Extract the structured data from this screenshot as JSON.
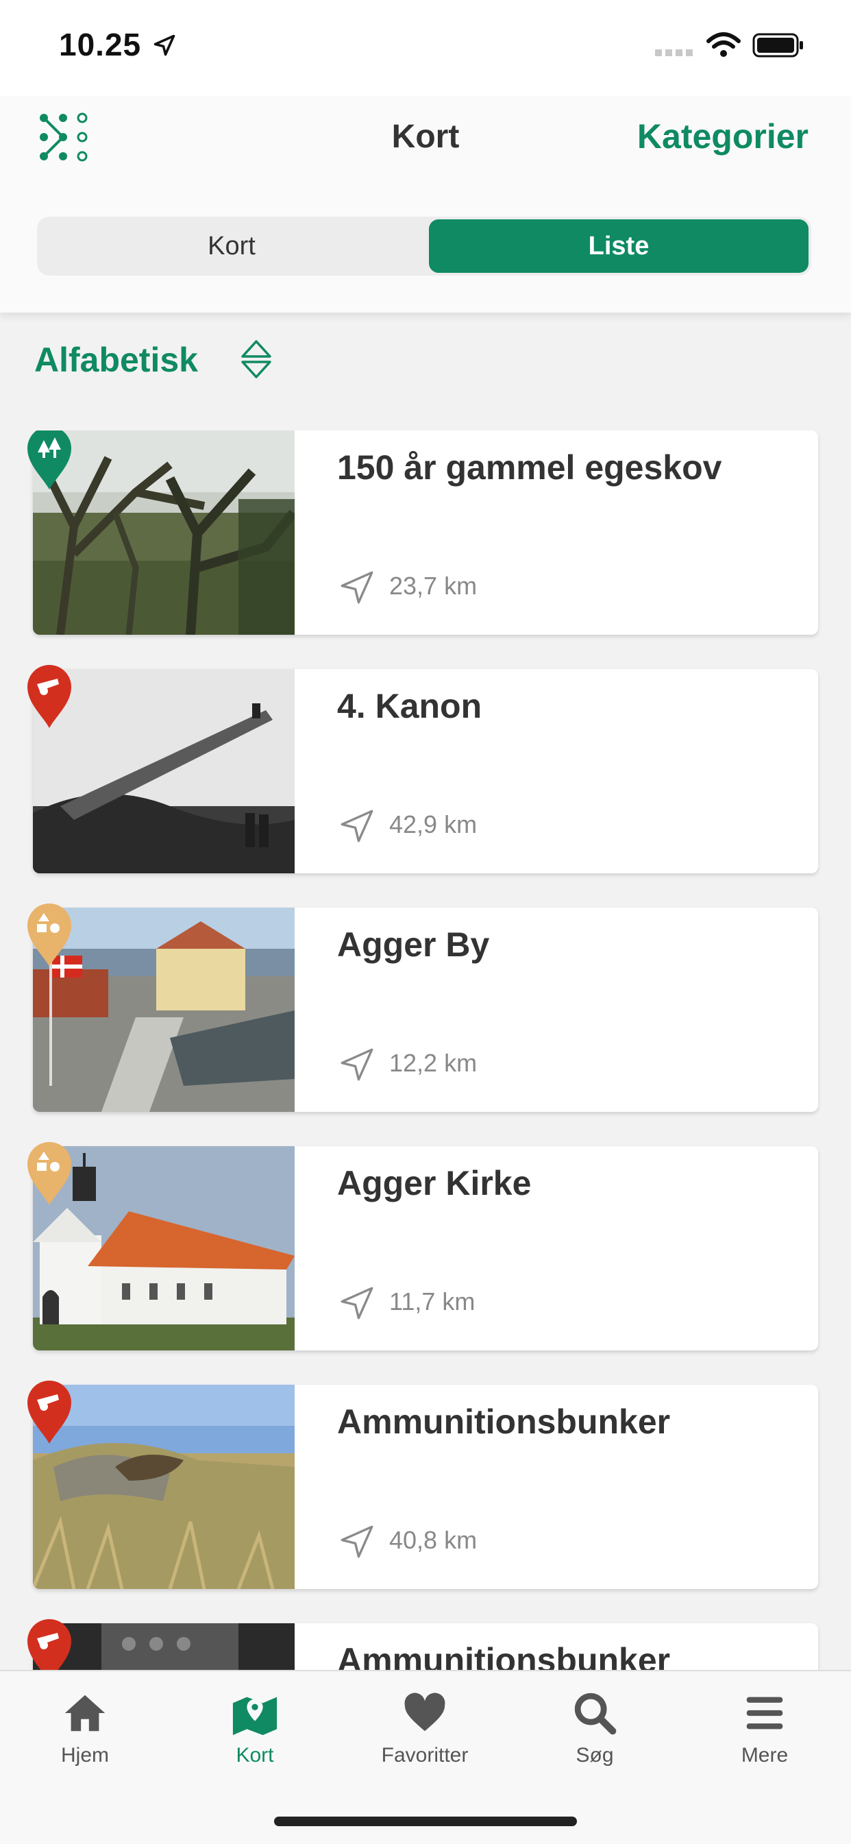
{
  "status_bar": {
    "time": "10.25",
    "icons": [
      "location-arrow-icon",
      "cellular-signal-icon",
      "wifi-icon",
      "battery-icon"
    ]
  },
  "nav": {
    "title": "Kort",
    "action": "Kategorier",
    "logo_icon": "app-logo-icon"
  },
  "segment": {
    "options": [
      "Kort",
      "Liste"
    ],
    "selected": "Liste"
  },
  "sort": {
    "label": "Alfabetisk",
    "icon": "sort-arrows-icon"
  },
  "items": [
    {
      "title": "150 år gammel egeskov",
      "distance": "23,7 km",
      "category_icon": "tree-pin-icon",
      "pin_color": "#0f8a63"
    },
    {
      "title": "4. Kanon",
      "distance": "42,9 km",
      "category_icon": "cannon-pin-icon",
      "pin_color": "#d32f1f"
    },
    {
      "title": "Agger By",
      "distance": "12,2 km",
      "category_icon": "culture-pin-icon",
      "pin_color": "#e8b36a"
    },
    {
      "title": "Agger Kirke",
      "distance": "11,7 km",
      "category_icon": "culture-pin-icon",
      "pin_color": "#e8b36a"
    },
    {
      "title": "Ammunitionsbunker",
      "distance": "40,8 km",
      "category_icon": "cannon-pin-icon",
      "pin_color": "#d32f1f"
    },
    {
      "title": "Ammunitionsbunker",
      "distance": "",
      "category_icon": "cannon-pin-icon",
      "pin_color": "#d32f1f"
    }
  ],
  "tabs": [
    {
      "label": "Hjem",
      "icon": "home-icon"
    },
    {
      "label": "Kort",
      "icon": "map-pin-icon",
      "active": true
    },
    {
      "label": "Favoritter",
      "icon": "heart-icon"
    },
    {
      "label": "Søg",
      "icon": "search-icon"
    },
    {
      "label": "Mere",
      "icon": "menu-icon"
    }
  ],
  "colors": {
    "accent": "#0f8a63",
    "red": "#d32f1f",
    "amber": "#e8b36a"
  }
}
